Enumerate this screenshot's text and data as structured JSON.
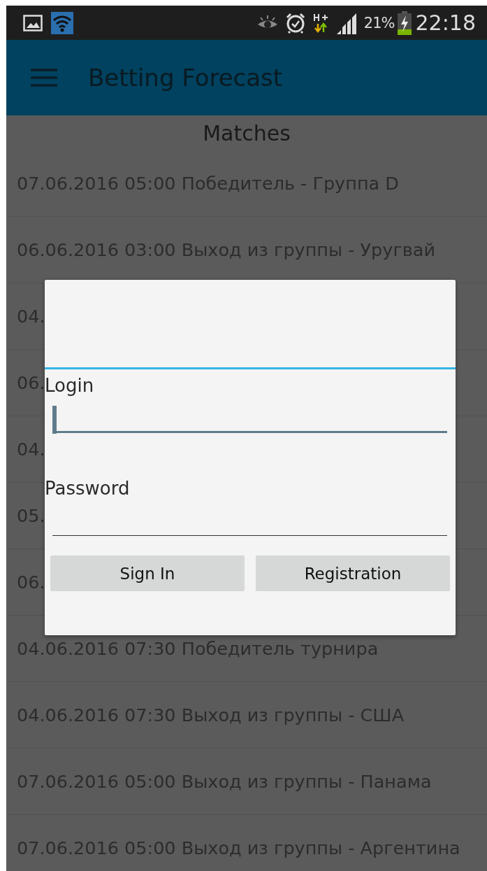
{
  "status_bar": {
    "battery": "21%",
    "time": "22:18"
  },
  "app_bar": {
    "title": "Betting Forecast"
  },
  "list": {
    "title": "Matches",
    "rows": [
      {
        "text": "07.06.2016 05:00 Победитель - Группа D"
      },
      {
        "text": "06.06.2016 03:00 Выход из группы - Уругвай"
      },
      {
        "text": "04."
      },
      {
        "text": "06."
      },
      {
        "text": "04."
      },
      {
        "text": "05."
      },
      {
        "text": "06."
      },
      {
        "text": "04.06.2016 07:30 Победитель турнира"
      },
      {
        "text": "04.06.2016 07:30 Выход из группы - США"
      },
      {
        "text": "07.06.2016 05:00 Выход из группы - Панама"
      },
      {
        "text": "07.06.2016 05:00 Выход из группы - Аргентина"
      }
    ]
  },
  "dialog": {
    "fields": [
      {
        "label": "Login",
        "focused": true
      },
      {
        "label": "Password",
        "focused": false
      }
    ],
    "buttons": [
      "Sign In",
      "Registration"
    ]
  }
}
